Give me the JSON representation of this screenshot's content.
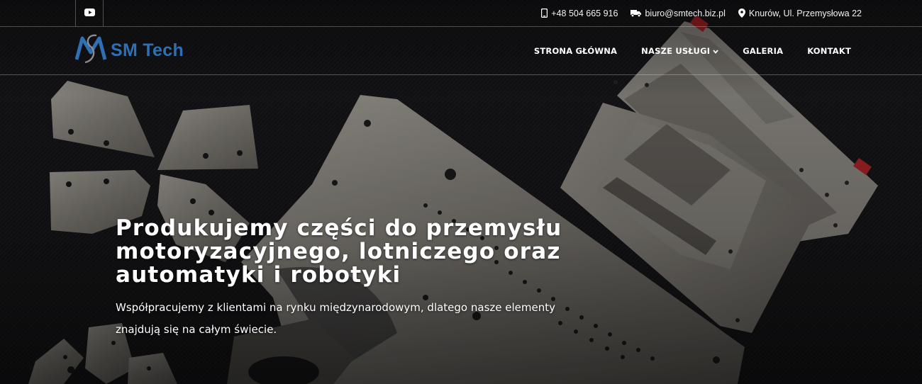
{
  "topbar": {
    "social": {
      "icon": "youtube-icon"
    },
    "contacts": [
      {
        "icon": "phone-icon",
        "text": "+48 504 665 916"
      },
      {
        "icon": "truck-icon",
        "text": "biuro@smtech.biz.pl"
      },
      {
        "icon": "map-pin-icon",
        "text": "Knurów, Ul. Przemysłowa 22"
      }
    ]
  },
  "header": {
    "logo_text": "SM Tech",
    "nav": [
      {
        "label": "STRONA GŁÓWNA"
      },
      {
        "label": "NASZE USŁUGI",
        "dropdown": true
      },
      {
        "label": "GALERIA"
      },
      {
        "label": "KONTAKT"
      }
    ]
  },
  "hero": {
    "title_lines": [
      "Produkujemy części do przemysłu",
      "motoryzacyjnego, lotniczego oraz",
      "automatyki i robotyki"
    ],
    "subtitle": "Współpracujemy z klientami na rynku międzynarodowym, dlatego nasze elementy znajdują się na całym świecie."
  },
  "colors": {
    "brand": "#2f6fb3",
    "background": "#141416",
    "text": "#ffffff"
  }
}
